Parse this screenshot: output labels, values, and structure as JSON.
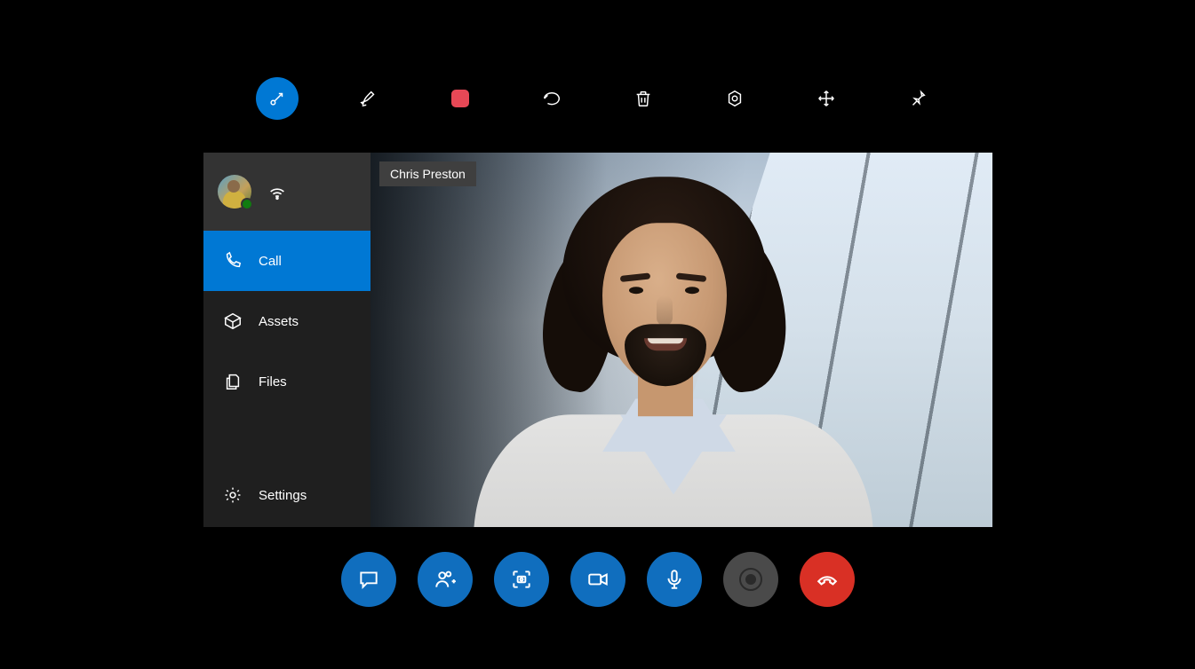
{
  "participant": {
    "name": "Chris Preston"
  },
  "sidebar": {
    "items": [
      {
        "label": "Call"
      },
      {
        "label": "Assets"
      },
      {
        "label": "Files"
      }
    ],
    "settings_label": "Settings"
  },
  "top_toolbar": {
    "icons": [
      "annotate",
      "pen",
      "record",
      "undo",
      "delete",
      "settings-hex",
      "move",
      "pin"
    ]
  },
  "call_controls": {
    "buttons": [
      "chat",
      "add-participant",
      "snapshot",
      "video",
      "mic",
      "record",
      "hangup"
    ]
  },
  "colors": {
    "accent": "#0078d4",
    "accent_dark": "#106ebe",
    "danger": "#d93025",
    "record_red": "#e74856",
    "presence_available": "#107c10"
  }
}
